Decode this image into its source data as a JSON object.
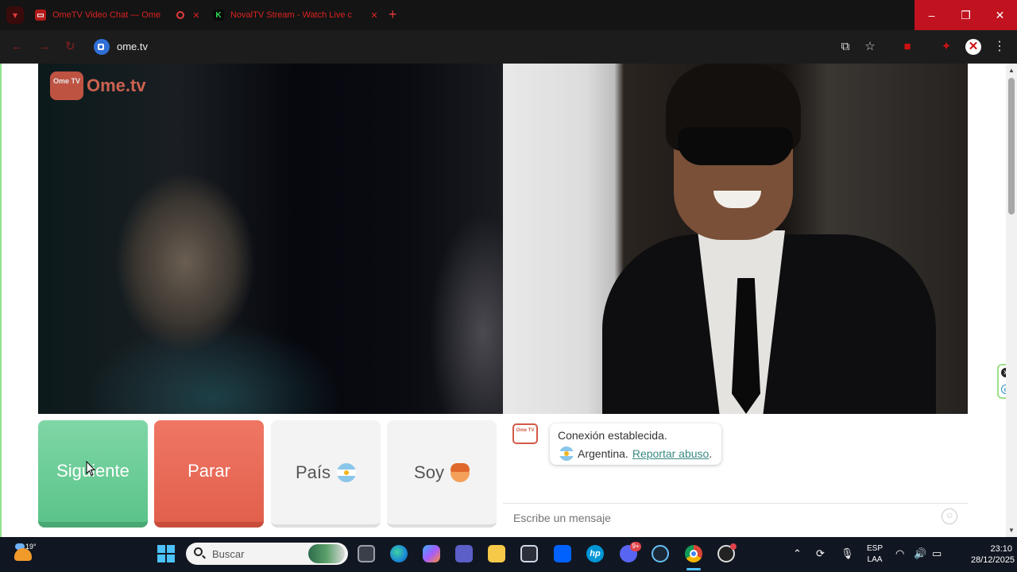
{
  "browser": {
    "tabs": [
      {
        "title": "OmeTV Video Chat — Ome",
        "favicon": "ometv-icon",
        "recording": true
      },
      {
        "title": "NovalTV Stream - Watch Live c",
        "favicon": "kick-icon"
      }
    ],
    "new_tab_symbol": "+",
    "window_controls": {
      "minimize": "–",
      "maximize": "❐",
      "close": "✕"
    },
    "url": "ome.tv",
    "accent_color": "#c1121f"
  },
  "site": {
    "logo_text": "Ome.tv",
    "logo_badge": "Ome TV"
  },
  "controls": {
    "next_label": "Siguiente",
    "stop_label": "Parar",
    "country_label": "País",
    "soy_label": "Soy",
    "colors": {
      "next": "#5bc48a",
      "stop": "#e2604c"
    }
  },
  "chat": {
    "system_line1": "Conexión establecida.",
    "country": "Argentina.",
    "report_link": "Reportar abuso",
    "report_suffix": ".",
    "message_placeholder": "Escribe un mensaje"
  },
  "taskbar": {
    "weather_temp": "19°",
    "search_placeholder": "Buscar",
    "discord_badge": "9+",
    "language_line1": "ESP",
    "language_line2": "LAA",
    "time": "23:10",
    "date": "28/12/2025"
  }
}
